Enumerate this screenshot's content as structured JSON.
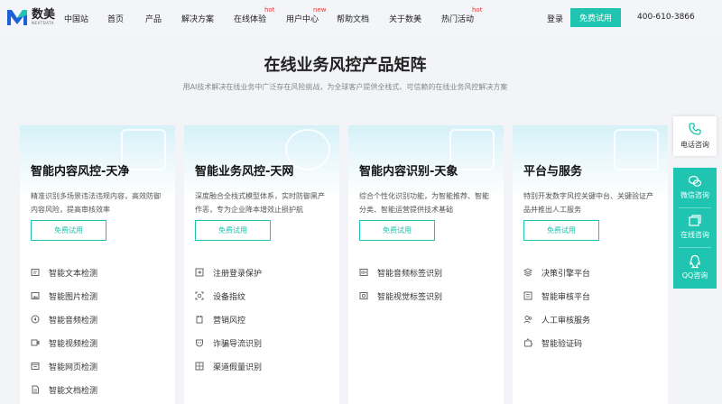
{
  "header": {
    "brand": "数美",
    "brand_en": "NEXTDATA",
    "nav": [
      {
        "label": "中国站",
        "badge": ""
      },
      {
        "label": "首页",
        "badge": ""
      },
      {
        "label": "产品",
        "badge": ""
      },
      {
        "label": "解决方案",
        "badge": ""
      },
      {
        "label": "在线体验",
        "badge": "hot"
      },
      {
        "label": "用户中心",
        "badge": "new"
      },
      {
        "label": "帮助文档",
        "badge": ""
      },
      {
        "label": "关于数美",
        "badge": ""
      },
      {
        "label": "热门活动",
        "badge": "hot"
      }
    ],
    "login": "登录",
    "trial": "免费试用",
    "phone": "400-610-3866"
  },
  "main": {
    "title": "在线业务风控产品矩阵",
    "subtitle": "用AI技术解决在线业务中广泛存在风险挑战，为全球客户提供全栈式、可信赖的在线业务风控解决方案"
  },
  "cards": [
    {
      "title": "智能内容风控-天净",
      "desc": "精准识别多场景违法违规内容，高效防御内容风险，提高审核效率",
      "button": "免费试用",
      "items": [
        {
          "label": "智能文本检测",
          "icon": "text-doc-icon"
        },
        {
          "label": "智能图片检测",
          "icon": "image-icon"
        },
        {
          "label": "智能音频检测",
          "icon": "audio-icon"
        },
        {
          "label": "智能视频检测",
          "icon": "video-icon"
        },
        {
          "label": "智能网页检测",
          "icon": "webpage-icon"
        },
        {
          "label": "智能文档检测",
          "icon": "document-icon"
        }
      ]
    },
    {
      "title": "智能业务风控-天网",
      "desc": "深度融合全栈式模型体系，实时防御黑产作恶，专为企业降本增效止损护航",
      "button": "免费试用",
      "items": [
        {
          "label": "注册登录保护",
          "icon": "login-icon"
        },
        {
          "label": "设备指纹",
          "icon": "fingerprint-icon"
        },
        {
          "label": "营销风控",
          "icon": "marketing-icon"
        },
        {
          "label": "诈骗导流识别",
          "icon": "fraud-icon"
        },
        {
          "label": "渠道假量识别",
          "icon": "channel-icon"
        }
      ]
    },
    {
      "title": "智能内容识别-天象",
      "desc": "综合个性化识别功能，为智能推荐、智能分类、智能运营提供技术基础",
      "button": "免费试用",
      "items": [
        {
          "label": "智能音频标签识别",
          "icon": "audio-tag-icon"
        },
        {
          "label": "智能视觉标签识别",
          "icon": "visual-tag-icon"
        }
      ]
    },
    {
      "title": "平台与服务",
      "desc": "特别开发数字风控关键中台、关键验证产品并推出人工服务",
      "button": "免费试用",
      "items": [
        {
          "label": "决策引擎平台",
          "icon": "layers-icon"
        },
        {
          "label": "智能审核平台",
          "icon": "review-icon"
        },
        {
          "label": "人工审核服务",
          "icon": "people-icon"
        },
        {
          "label": "智能验证码",
          "icon": "puzzle-icon"
        }
      ]
    }
  ],
  "side": {
    "phone": "电话咨询",
    "wechat": "微信咨询",
    "online": "在线咨询",
    "qq": "QQ咨询"
  },
  "colors": {
    "accent": "#1fc5b0",
    "hot": "#e23a3a",
    "brand": "#1d5fd6"
  }
}
